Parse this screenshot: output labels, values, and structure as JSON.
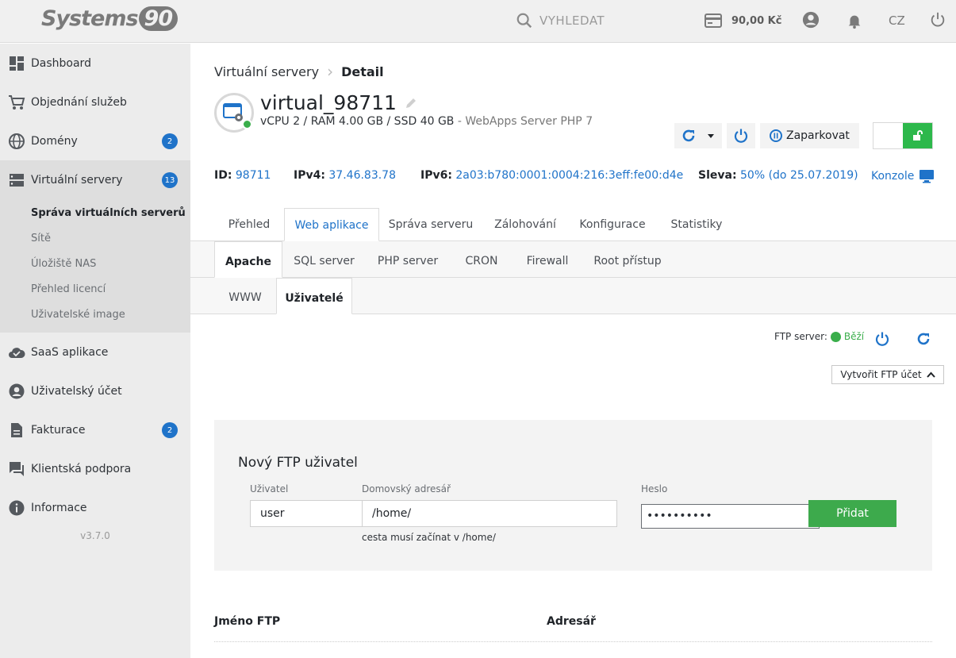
{
  "brand": {
    "name_text": "Systems",
    "name_num": "90"
  },
  "topbar": {
    "search_placeholder": "VYHLEDAT",
    "credit": "90,00 Kč",
    "language": "CZ",
    "icons": [
      "search-icon",
      "card-icon",
      "user-icon",
      "bell-icon",
      "power-icon"
    ]
  },
  "sidebar": {
    "items": [
      {
        "label": "Dashboard",
        "icon": "dashboard-icon"
      },
      {
        "label": "Objednání služeb",
        "icon": "cart-icon"
      },
      {
        "label": "Domény",
        "icon": "globe-icon",
        "badge": "2"
      },
      {
        "label": "Virtuální servery",
        "icon": "server-icon",
        "badge": "13"
      },
      {
        "label": "SaaS aplikace",
        "icon": "cloud-icon"
      },
      {
        "label": "Uživatelský účet",
        "icon": "account-icon"
      },
      {
        "label": "Fakturace",
        "icon": "document-icon",
        "badge": "2"
      },
      {
        "label": "Klientská podpora",
        "icon": "chat-icon"
      },
      {
        "label": "Informace",
        "icon": "info-icon"
      }
    ],
    "subitems": [
      "Správa virtuálních serverů",
      "Sítě",
      "Úložiště NAS",
      "Přehled licencí",
      "Uživatelské image"
    ],
    "version": "v3.7.0"
  },
  "breadcrumb": {
    "parent": "Virtuální servery",
    "current": "Detail"
  },
  "server": {
    "name": "virtual_98711",
    "spec": "vCPU 2 / RAM 4.00 GB / SSD 40 GB",
    "spec_sub": " - WebApps Server PHP 7",
    "park_label": "Zaparkovat",
    "id_label": "ID:",
    "id": "98711",
    "ipv4_label": "IPv4:",
    "ipv4": "37.46.83.78",
    "ipv6_label": "IPv6:",
    "ipv6": "2a03:b780:0001:0004:216:3eff:fe00:d4e",
    "discount_label": "Sleva:",
    "discount": "50% (do 25.07.2019)",
    "console_label": "Konzole"
  },
  "tabs_main": [
    "Přehled",
    "Web aplikace",
    "Správa serveru",
    "Zálohování",
    "Konfigurace",
    "Statistiky"
  ],
  "tabs_sub": [
    "Apache",
    "SQL server",
    "PHP server",
    "CRON",
    "Firewall",
    "Root přístup"
  ],
  "tabs_sub2": [
    "WWW",
    "Uživatelé"
  ],
  "ftp": {
    "status_label": "FTP server:",
    "status_value": "Běží",
    "create_label": "Vytvořit FTP účet",
    "form_title": "Nový FTP uživatel",
    "user_label": "Uživatel",
    "user_value": "user",
    "home_label": "Domovský adresář",
    "home_value": "/home/",
    "home_hint": "cesta musí začínat v /home/",
    "pwd_label": "Heslo",
    "pwd_value": "••••••••••",
    "add_label": "Přidat",
    "col_name": "Jméno FTP",
    "col_dir": "Adresář"
  },
  "colors": {
    "accent": "#1f73c9",
    "success": "#3aae4b",
    "sidebar": "#ececec"
  }
}
